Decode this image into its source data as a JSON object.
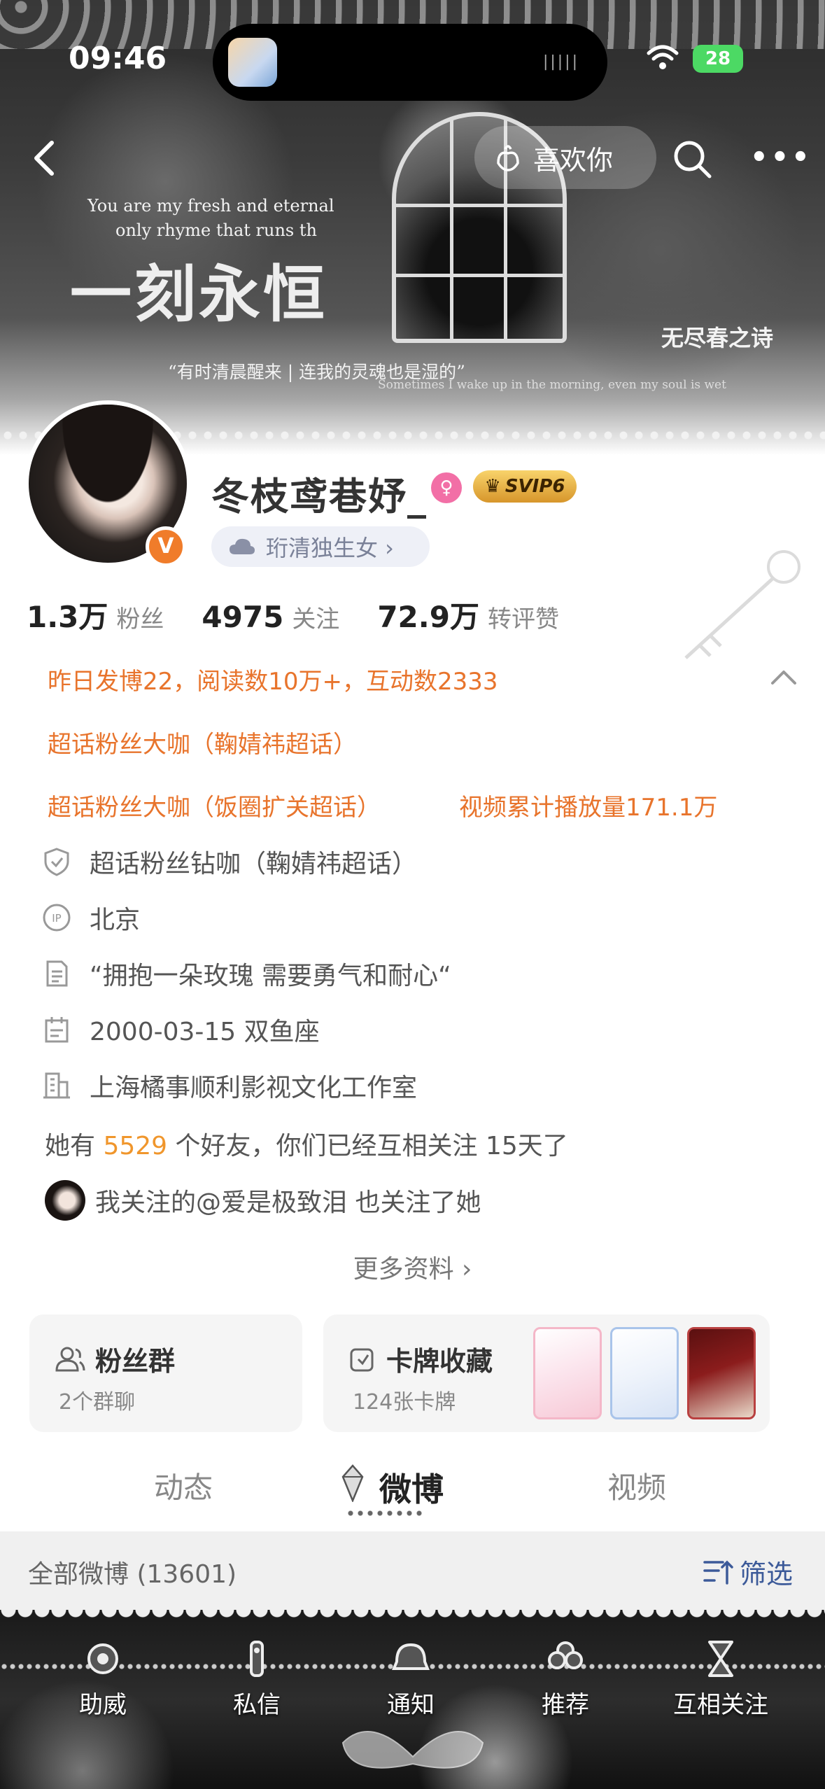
{
  "status_bar": {
    "time": "09:46",
    "battery": "28"
  },
  "nav": {
    "like_label": "喜欢你"
  },
  "banner": {
    "line1": "You are my fresh and eternal",
    "line2": "only rhyme that runs th",
    "big_text": "一刻永恒",
    "quote": "“有时清晨醒来 | 连我的灵魂也是湿的”",
    "quote_sub": "Sometimes I wake up in the morning, even my soul is wet",
    "right_text": "无尽春之诗"
  },
  "profile": {
    "username": "冬枝鸢巷妤_",
    "svip_label": "SVIP6",
    "fan_tag": "珩清独生女 ›"
  },
  "stats": [
    {
      "value": "1.3万",
      "label": "粉丝"
    },
    {
      "value": "4975",
      "label": "关注"
    },
    {
      "value": "72.9万",
      "label": "转评赞"
    }
  ],
  "highlights": {
    "yesterday": "昨日发博22，阅读数10万+，互动数2333",
    "superfan1": "超话粉丝大咖（鞠婧祎超话）",
    "superfan2": "超话粉丝大咖（饭圈扩关超话）",
    "video_plays": "视频累计播放量171.1万"
  },
  "info": {
    "superfan_diamond": "超话粉丝钻咖（鞠婧祎超话）",
    "ip": "北京",
    "bio": "“拥抱一朵玫瑰 需要勇气和耐心“",
    "birthday": "2000-03-15 双鱼座",
    "company": "上海橘事顺利影视文化工作室"
  },
  "friends": {
    "prefix": "她有 ",
    "count": "5529",
    "suffix": " 个好友，你们已经互相关注 15天了"
  },
  "mutual": {
    "text": "我关注的@爱是极致泪 也关注了她"
  },
  "more_info": "更多资料 ›",
  "cards": {
    "fans_group": {
      "title": "粉丝群",
      "sub": "2个群聊"
    },
    "card_collection": {
      "title": "卡牌收藏",
      "sub": "124张卡牌"
    }
  },
  "tabs": [
    "动态",
    "微博",
    "视频"
  ],
  "filter_bar": {
    "title": "全部微博 (13601)",
    "filter_label": "筛选"
  },
  "bottom_bar": [
    "助威",
    "私信",
    "通知",
    "推荐",
    "互相关注"
  ],
  "colors": {
    "accent_orange": "#e8742c",
    "friend_count": "#f0962c",
    "filter_blue": "#3c5a99",
    "verified": "#f07c2a"
  }
}
